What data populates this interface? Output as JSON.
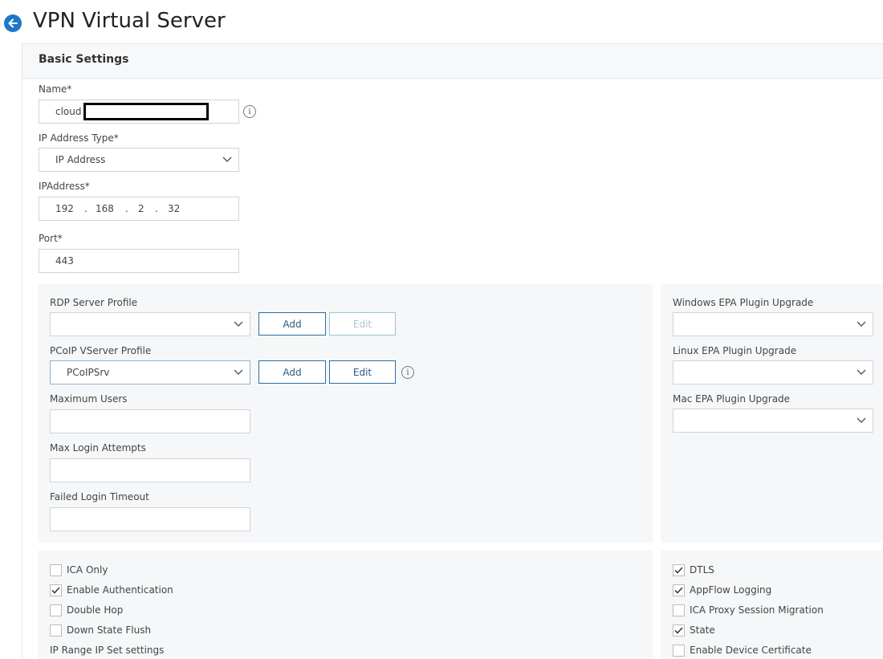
{
  "page": {
    "title": "VPN Virtual Server"
  },
  "basic": {
    "title": "Basic Settings",
    "name_label": "Name*",
    "name_value": "cloud",
    "ip_type_label": "IP Address Type*",
    "ip_type_value": "IP Address",
    "ip_label": "IPAddress*",
    "ip": [
      "192",
      "168",
      "2",
      "32"
    ],
    "ip_sep": ".",
    "port_label": "Port*",
    "port_value": "443"
  },
  "left_section": {
    "rdp_label": "RDP Server Profile",
    "rdp_value": "",
    "pcoip_label": "PCoIP VServer Profile",
    "pcoip_value": "PCoIPSrv",
    "add_label": "Add",
    "edit_label": "Edit",
    "max_users_label": "Maximum Users",
    "max_users_value": "",
    "max_login_label": "Max Login Attempts",
    "max_login_value": "",
    "failed_login_label": "Failed Login Timeout",
    "failed_login_value": ""
  },
  "right_section": {
    "windows_label": "Windows EPA Plugin Upgrade",
    "linux_label": "Linux EPA Plugin Upgrade",
    "mac_label": "Mac EPA Plugin Upgrade"
  },
  "checkboxes_left": [
    {
      "label": "ICA Only",
      "checked": false
    },
    {
      "label": "Enable Authentication",
      "checked": true
    },
    {
      "label": "Double Hop",
      "checked": false
    },
    {
      "label": "Down State Flush",
      "checked": false
    }
  ],
  "ip_range_label": "IP Range IP Set settings",
  "checkboxes_right": [
    {
      "label": "DTLS",
      "checked": true
    },
    {
      "label": "AppFlow Logging",
      "checked": true
    },
    {
      "label": "ICA Proxy Session Migration",
      "checked": false
    },
    {
      "label": "State",
      "checked": true
    },
    {
      "label": "Enable Device Certificate",
      "checked": false
    }
  ],
  "colors": {
    "accent": "#1e78c8",
    "button_border": "#2e6e9e",
    "section_bg": "#f5f7f9"
  }
}
